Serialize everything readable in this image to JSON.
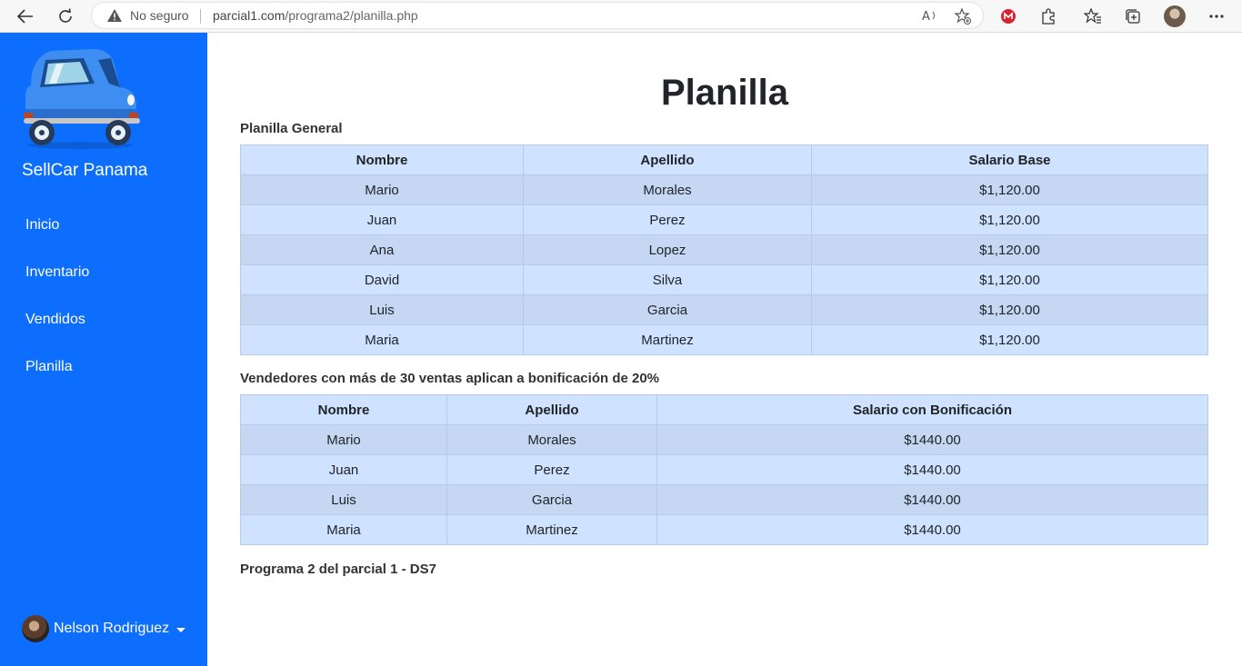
{
  "browser": {
    "security_label": "No seguro",
    "url_domain": "parcial1.com",
    "url_path": "/programa2/planilla.php"
  },
  "sidebar": {
    "brand": "SellCar Panama",
    "items": [
      {
        "label": "Inicio"
      },
      {
        "label": "Inventario"
      },
      {
        "label": "Vendidos"
      },
      {
        "label": "Planilla"
      }
    ],
    "user_name": "Nelson Rodriguez",
    "bg_color": "#0d6efd"
  },
  "main": {
    "title": "Planilla",
    "general": {
      "caption": "Planilla General",
      "headers": [
        "Nombre",
        "Apellido",
        "Salario Base"
      ],
      "rows": [
        [
          "Mario",
          "Morales",
          "$1,120.00"
        ],
        [
          "Juan",
          "Perez",
          "$1,120.00"
        ],
        [
          "Ana",
          "Lopez",
          "$1,120.00"
        ],
        [
          "David",
          "Silva",
          "$1,120.00"
        ],
        [
          "Luis",
          "Garcia",
          "$1,120.00"
        ],
        [
          "Maria",
          "Martinez",
          "$1,120.00"
        ]
      ]
    },
    "bonus": {
      "caption": "Vendedores con más de 30 ventas aplican a bonificación de 20%",
      "headers": [
        "Nombre",
        "Apellido",
        "Salario con Bonificación"
      ],
      "rows": [
        [
          "Mario",
          "Morales",
          "$1440.00"
        ],
        [
          "Juan",
          "Perez",
          "$1440.00"
        ],
        [
          "Luis",
          "Garcia",
          "$1440.00"
        ],
        [
          "Maria",
          "Martinez",
          "$1440.00"
        ]
      ]
    },
    "footer": "Programa 2 del parcial 1 - DS7"
  },
  "icons": [
    "back-arrow-icon",
    "refresh-icon",
    "warning-icon",
    "read-aloud-icon",
    "favorite-add-icon",
    "extension-red-icon",
    "extensions-icon",
    "favorites-icon",
    "collections-icon",
    "profile-icon",
    "more-icon",
    "car-logo-icon",
    "caret-down-icon"
  ]
}
